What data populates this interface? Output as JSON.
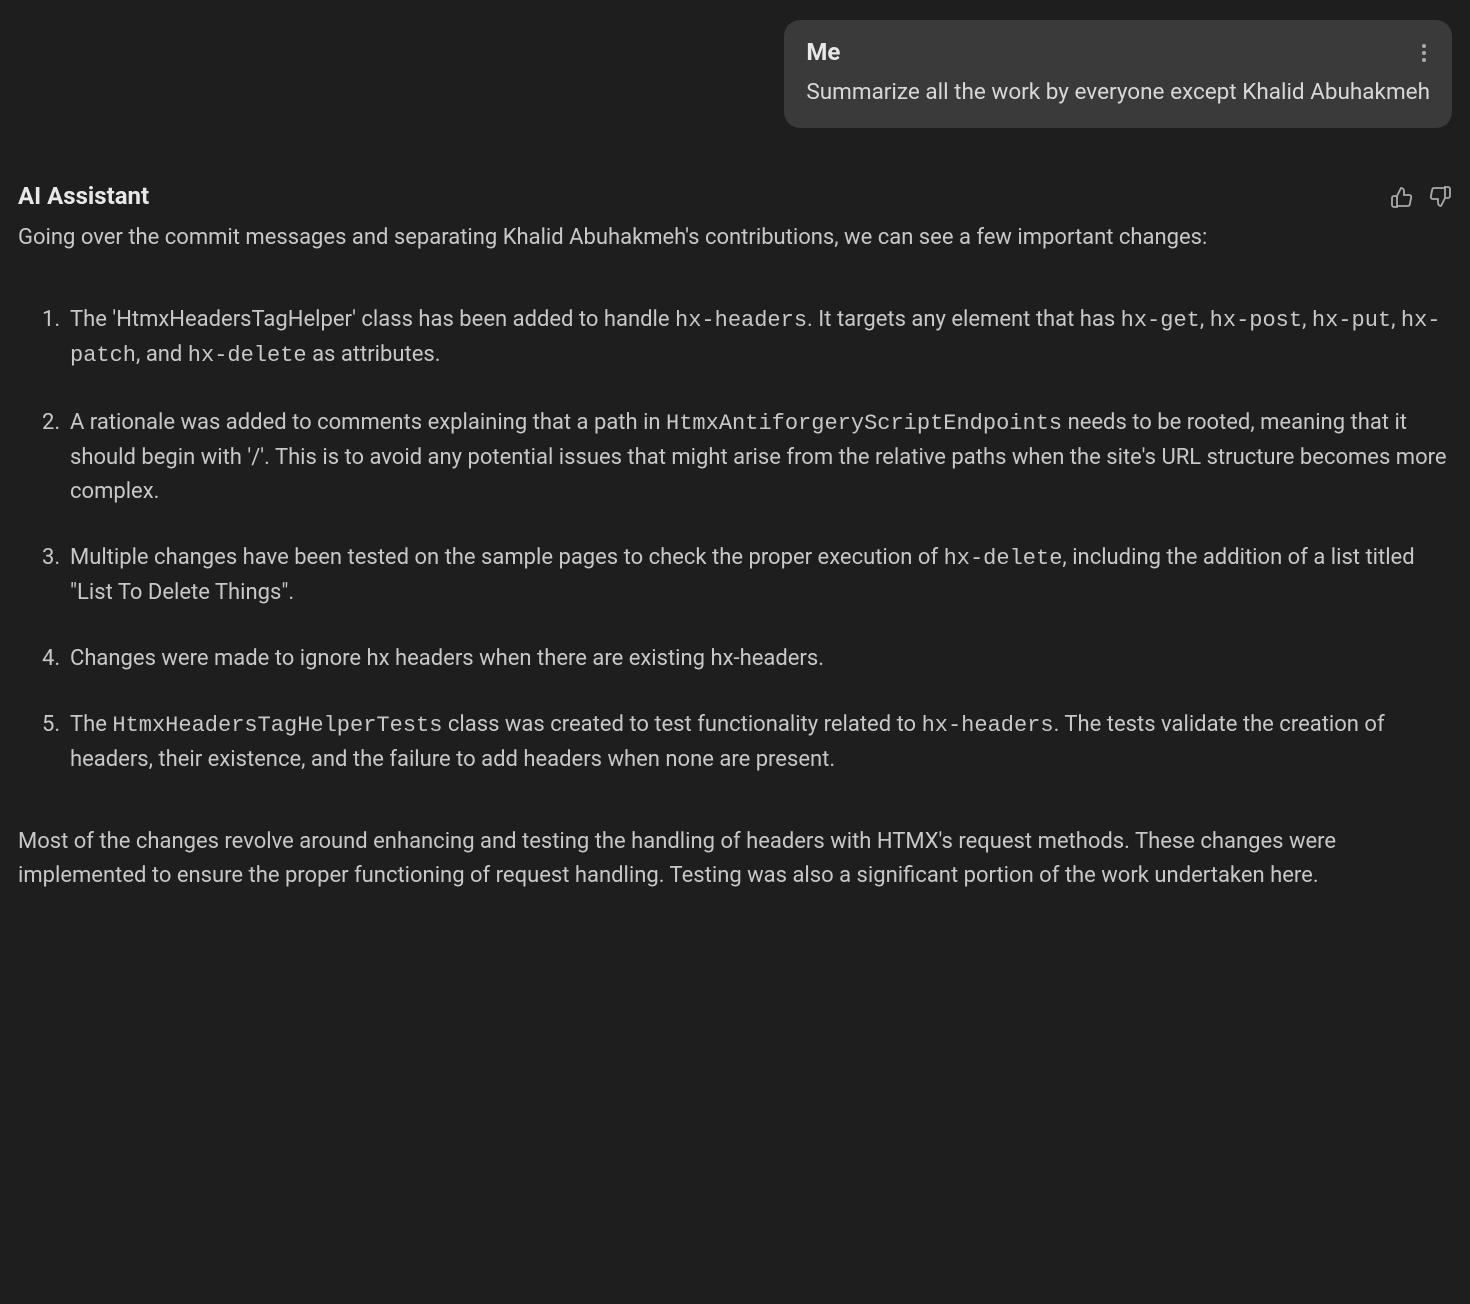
{
  "user": {
    "name": "Me",
    "message": "Summarize all the work by everyone except Khalid Abuhakmeh"
  },
  "assistant": {
    "name": "AI Assistant",
    "intro": "Going over the commit messages and separating Khalid Abuhakmeh's contributions, we can see a few important changes:",
    "items": {
      "i1_a": "The 'HtmxHeadersTagHelper' class has been added to handle ",
      "i1_c1": "hx-headers",
      "i1_b": ". It targets any element that has ",
      "i1_c2": "hx-get",
      "i1_s1": ", ",
      "i1_c3": "hx-post",
      "i1_s2": ", ",
      "i1_c4": "hx-put",
      "i1_s3": ", ",
      "i1_c5": "hx-patch",
      "i1_s4": ", ",
      "i1_and": " and ",
      "i1_c6": "hx-delete",
      "i1_e": " as attributes.",
      "i2_a": "A rationale was added to comments explaining that a path in ",
      "i2_c1": "HtmxAntiforgeryScriptEndpoints",
      "i2_b": " needs to be rooted, meaning that it should begin with '/'. This is to avoid any potential issues that might arise from the relative paths when the site's URL structure becomes more complex.",
      "i3_a": "Multiple changes have been tested on the sample pages to check the proper execution of ",
      "i3_c1": "hx-delete",
      "i3_b": ", including the addition of a list titled \"List To Delete Things\".",
      "i4": "Changes were made to ignore hx headers when there are existing hx-headers.",
      "i5_a": "The ",
      "i5_c1": "HtmxHeadersTagHelperTests",
      "i5_b": " class was created to test functionality related to ",
      "i5_c2": "hx-headers",
      "i5_c": ". The tests validate the creation of headers, their existence, and the failure to add headers when none are present."
    },
    "summary": "Most of the changes revolve around enhancing and testing the handling of headers with HTMX's request methods. These changes were implemented to ensure the proper functioning of request handling. Testing was also a significant portion of the work undertaken here."
  }
}
